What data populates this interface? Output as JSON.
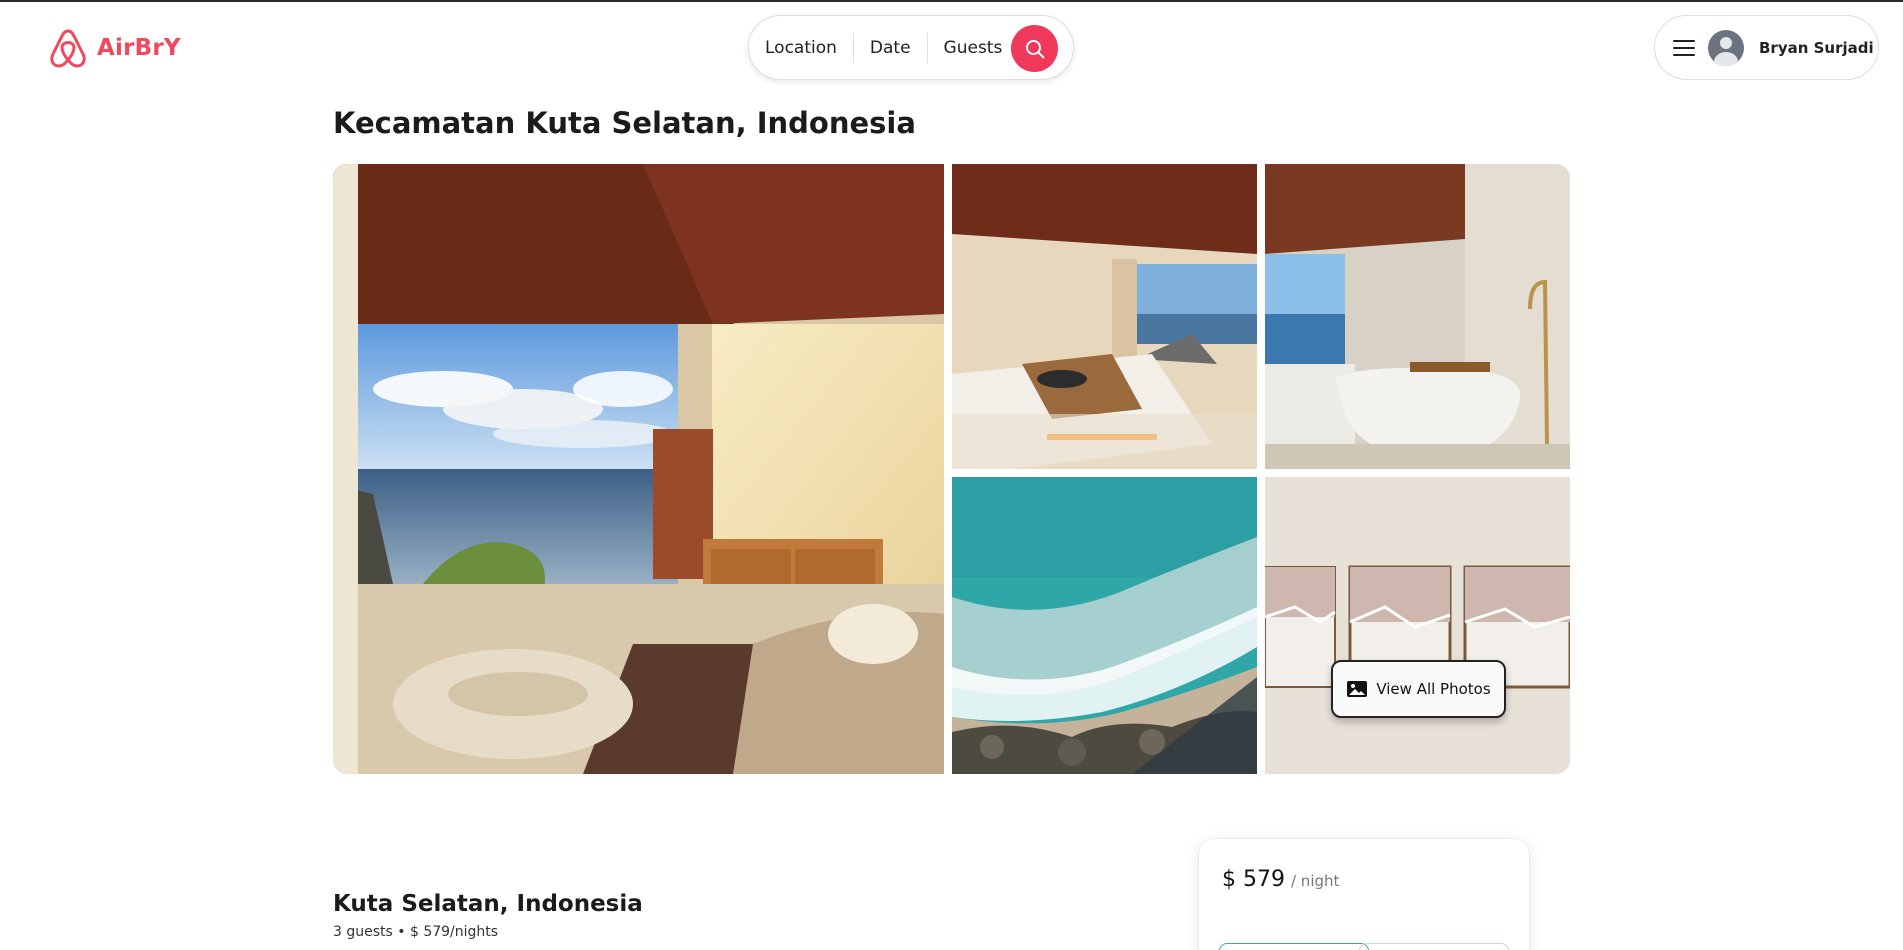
{
  "brand": {
    "name": "AirBrY",
    "color": "#f0485d",
    "icon": "airbnb-logo-icon"
  },
  "search": {
    "location_label": "Location",
    "date_label": "Date",
    "guests_label": "Guests",
    "button_icon": "search-icon",
    "button_color": "#f0385a"
  },
  "user_menu": {
    "menu_icon": "hamburger-menu-icon",
    "avatar_icon": "user-avatar-icon",
    "user_name": "Bryan Surjadi"
  },
  "page_title": "Kecamatan Kuta Selatan, Indonesia",
  "gallery": {
    "photos": [
      "ocean-view-living-room-photo",
      "bedroom-ocean-view-photo",
      "bathroom-bathtub-photo",
      "beach-waves-aerial-photo",
      "wall-art-frames-photo"
    ],
    "view_all_label": "View All Photos",
    "view_all_icon": "image-icon"
  },
  "listing": {
    "title": "Kuta Selatan, Indonesia",
    "summary": "3 guests • $ 579/nights"
  },
  "price_card": {
    "amount": "$ 579",
    "unit": "/ night"
  }
}
